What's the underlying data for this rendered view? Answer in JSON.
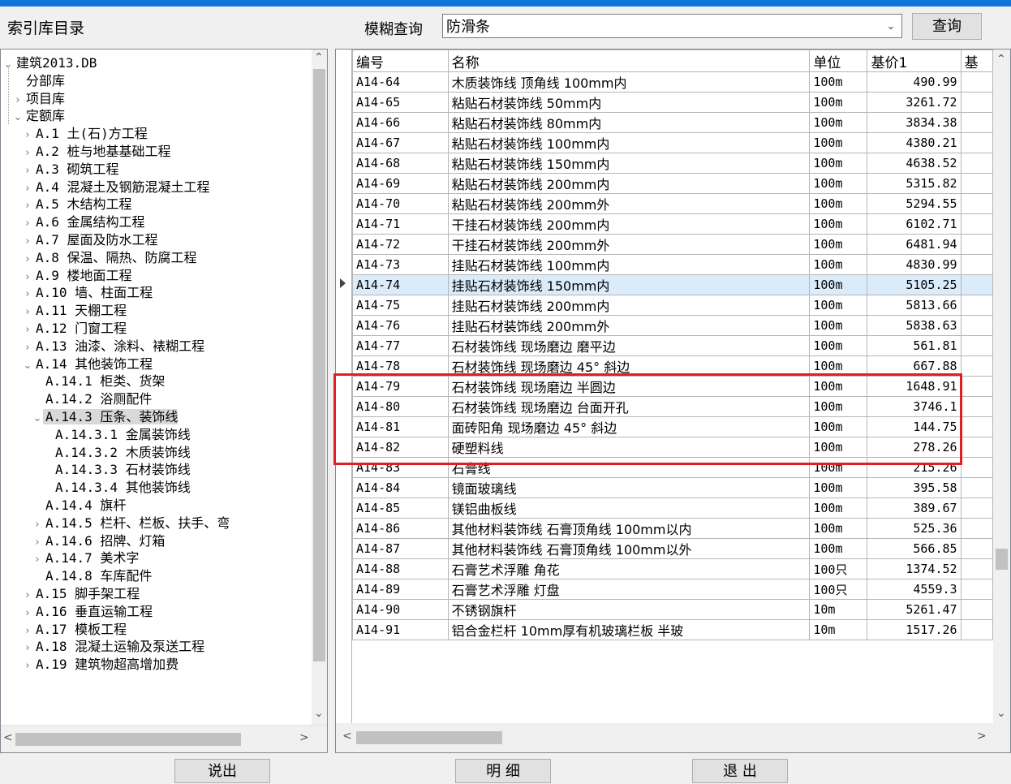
{
  "header": {
    "index_title": "索引库目录",
    "search_label": "模糊查询",
    "search_value": "防滑条",
    "query_button": "查询"
  },
  "tree": {
    "items": [
      {
        "label": "建筑2013.DB",
        "expander": "⌄"
      },
      {
        "label": "分部库",
        "expander": ""
      },
      {
        "label": "项目库",
        "expander": "›"
      },
      {
        "label": "定额库",
        "expander": "⌄"
      },
      {
        "label": "A.1 土(石)方工程",
        "expander": "›"
      },
      {
        "label": "A.2 桩与地基基础工程",
        "expander": "›"
      },
      {
        "label": "A.3 砌筑工程",
        "expander": "›"
      },
      {
        "label": "A.4 混凝土及钢筋混凝土工程",
        "expander": "›"
      },
      {
        "label": "A.5 木结构工程",
        "expander": "›"
      },
      {
        "label": "A.6 金属结构工程",
        "expander": "›"
      },
      {
        "label": "A.7 屋面及防水工程",
        "expander": "›"
      },
      {
        "label": "A.8 保温、隔热、防腐工程",
        "expander": "›"
      },
      {
        "label": "A.9 楼地面工程",
        "expander": "›"
      },
      {
        "label": "A.10 墙、柱面工程",
        "expander": "›"
      },
      {
        "label": "A.11 天棚工程",
        "expander": "›"
      },
      {
        "label": "A.12 门窗工程",
        "expander": "›"
      },
      {
        "label": "A.13 油漆、涂料、裱糊工程",
        "expander": "›"
      },
      {
        "label": "A.14 其他装饰工程",
        "expander": "⌄"
      },
      {
        "label": "A.14.1 柜类、货架",
        "expander": ""
      },
      {
        "label": "A.14.2 浴厕配件",
        "expander": ""
      },
      {
        "label": "A.14.3 压条、装饰线",
        "expander": "⌄"
      },
      {
        "label": "A.14.3.1 金属装饰线",
        "expander": ""
      },
      {
        "label": "A.14.3.2 木质装饰线",
        "expander": ""
      },
      {
        "label": "A.14.3.3 石材装饰线",
        "expander": ""
      },
      {
        "label": "A.14.3.4 其他装饰线",
        "expander": ""
      },
      {
        "label": "A.14.4 旗杆",
        "expander": ""
      },
      {
        "label": "A.14.5 栏杆、栏板、扶手、弯",
        "expander": "›"
      },
      {
        "label": "A.14.6 招牌、灯箱",
        "expander": "›"
      },
      {
        "label": "A.14.7 美术字",
        "expander": "›"
      },
      {
        "label": "A.14.8 车库配件",
        "expander": ""
      },
      {
        "label": "A.15 脚手架工程",
        "expander": "›"
      },
      {
        "label": "A.16 垂直运输工程",
        "expander": "›"
      },
      {
        "label": "A.17 模板工程",
        "expander": "›"
      },
      {
        "label": "A.18 混凝土运输及泵送工程",
        "expander": "›"
      },
      {
        "label": "A.19 建筑物超高增加费",
        "expander": "›"
      }
    ]
  },
  "grid": {
    "columns": [
      "编号",
      "名称",
      "单位",
      "基价1",
      "基"
    ],
    "rows": [
      {
        "code": "A14-64",
        "name": "木质装饰线 顶角线 100mm内",
        "unit": "100m",
        "price": "490.99"
      },
      {
        "code": "A14-65",
        "name": "粘贴石材装饰线 50mm内",
        "unit": "100m",
        "price": "3261.72"
      },
      {
        "code": "A14-66",
        "name": "粘贴石材装饰线 80mm内",
        "unit": "100m",
        "price": "3834.38"
      },
      {
        "code": "A14-67",
        "name": "粘贴石材装饰线 100mm内",
        "unit": "100m",
        "price": "4380.21"
      },
      {
        "code": "A14-68",
        "name": "粘贴石材装饰线 150mm内",
        "unit": "100m",
        "price": "4638.52"
      },
      {
        "code": "A14-69",
        "name": "粘贴石材装饰线 200mm内",
        "unit": "100m",
        "price": "5315.82"
      },
      {
        "code": "A14-70",
        "name": "粘贴石材装饰线 200mm外",
        "unit": "100m",
        "price": "5294.55"
      },
      {
        "code": "A14-71",
        "name": "干挂石材装饰线 200mm内",
        "unit": "100m",
        "price": "6102.71"
      },
      {
        "code": "A14-72",
        "name": "干挂石材装饰线 200mm外",
        "unit": "100m",
        "price": "6481.94"
      },
      {
        "code": "A14-73",
        "name": "挂贴石材装饰线 100mm内",
        "unit": "100m",
        "price": "4830.99"
      },
      {
        "code": "A14-74",
        "name": "挂贴石材装饰线 150mm内",
        "unit": "100m",
        "price": "5105.25"
      },
      {
        "code": "A14-75",
        "name": "挂贴石材装饰线 200mm内",
        "unit": "100m",
        "price": "5813.66"
      },
      {
        "code": "A14-76",
        "name": "挂贴石材装饰线 200mm外",
        "unit": "100m",
        "price": "5838.63"
      },
      {
        "code": "A14-77",
        "name": "石材装饰线 现场磨边 磨平边",
        "unit": "100m",
        "price": "561.81"
      },
      {
        "code": "A14-78",
        "name": "石材装饰线 现场磨边 45° 斜边",
        "unit": "100m",
        "price": "667.88"
      },
      {
        "code": "A14-79",
        "name": "石材装饰线 现场磨边 半圆边",
        "unit": "100m",
        "price": "1648.91"
      },
      {
        "code": "A14-80",
        "name": "石材装饰线 现场磨边 台面开孔",
        "unit": "100m",
        "price": "3746.1"
      },
      {
        "code": "A14-81",
        "name": "面砖阳角 现场磨边 45° 斜边",
        "unit": "100m",
        "price": "144.75"
      },
      {
        "code": "A14-82",
        "name": "硬塑料线",
        "unit": "100m",
        "price": "278.26"
      },
      {
        "code": "A14-83",
        "name": "石膏线",
        "unit": "100m",
        "price": "215.26"
      },
      {
        "code": "A14-84",
        "name": "镜面玻璃线",
        "unit": "100m",
        "price": "395.58"
      },
      {
        "code": "A14-85",
        "name": "镁铝曲板线",
        "unit": "100m",
        "price": "389.67"
      },
      {
        "code": "A14-86",
        "name": "其他材料装饰线 石膏顶角线 100mm以内",
        "unit": "100m",
        "price": "525.36"
      },
      {
        "code": "A14-87",
        "name": "其他材料装饰线 石膏顶角线 100mm以外",
        "unit": "100m",
        "price": "566.85"
      },
      {
        "code": "A14-88",
        "name": "石膏艺术浮雕 角花",
        "unit": "100只",
        "price": "1374.52"
      },
      {
        "code": "A14-89",
        "name": "石膏艺术浮雕 灯盘",
        "unit": "100只",
        "price": "4559.3"
      },
      {
        "code": "A14-90",
        "name": "不锈钢旗杆",
        "unit": "10m",
        "price": "5261.47"
      },
      {
        "code": "A14-91",
        "name": "铝合金栏杆 10mm厚有机玻璃栏板 半玻",
        "unit": "10m",
        "price": "1517.26"
      }
    ]
  },
  "footer": {
    "btn1": "说出",
    "btn2": "明 细",
    "btn3": "退 出"
  }
}
